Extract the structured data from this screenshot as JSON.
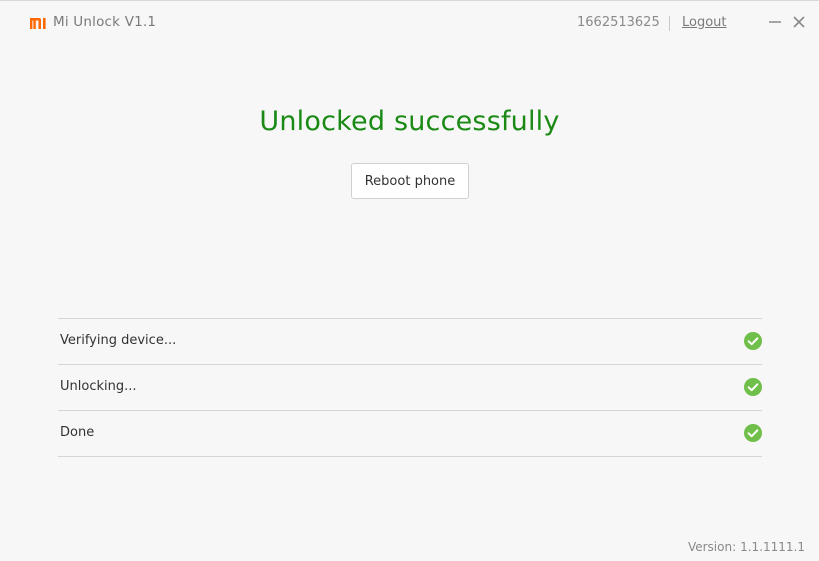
{
  "window": {
    "app_name": "Mi Unlock",
    "version_label": "V1.1",
    "user_id": "1662513625",
    "logout_label": "Logout",
    "logo_icon": "mi-logo-icon",
    "brand_color": "#ff6700"
  },
  "main": {
    "headline": "Unlocked successfully",
    "headline_color": "#1a8a14",
    "reboot_label": "Reboot phone"
  },
  "steps": [
    {
      "label": "Verifying device...",
      "status_icon": "check-circle-icon",
      "done": true
    },
    {
      "label": "Unlocking...",
      "status_icon": "check-circle-icon",
      "done": true
    },
    {
      "label": "Done",
      "status_icon": "check-circle-icon",
      "done": true
    }
  ],
  "check_color": "#6fbf4a",
  "footer": {
    "version_prefix": "Version:",
    "version_number": "1.1.1111.1"
  }
}
